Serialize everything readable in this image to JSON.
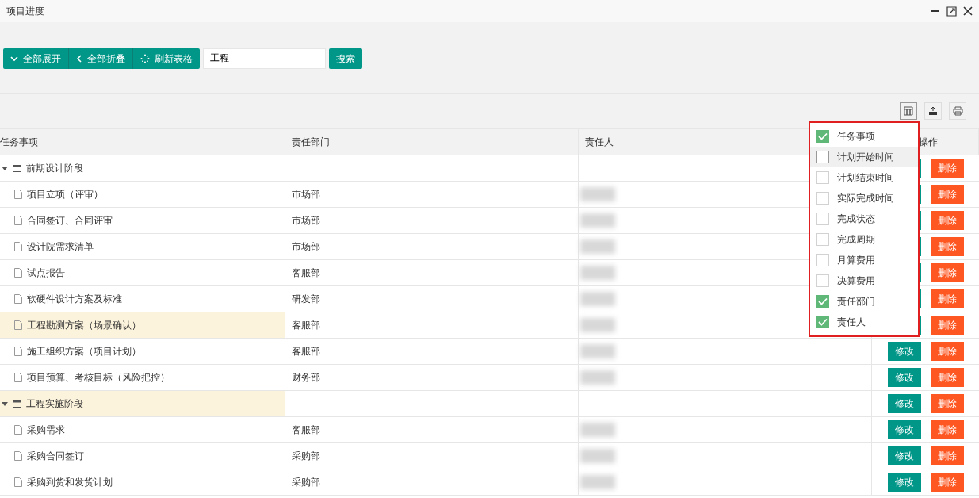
{
  "window": {
    "title": "项目进度"
  },
  "toolbar": {
    "buttons": [
      {
        "kind": "expand",
        "label": "全部展开"
      },
      {
        "kind": "collapse",
        "label": "全部折叠"
      },
      {
        "kind": "refresh",
        "label": "刷新表格"
      }
    ],
    "search": {
      "value": "工程"
    },
    "search_button": "搜索"
  },
  "table": {
    "columns": [
      "任务事项",
      "责任部门",
      "责任人",
      "操作"
    ],
    "rows": [
      {
        "kind": "group",
        "task": "前期设计阶段",
        "expanded": true,
        "highlighted": false,
        "actions": [
          "删除"
        ]
      },
      {
        "kind": "item",
        "task": "项目立项（评审）",
        "dept": "市场部",
        "highlighted": false,
        "actions": [
          "删除"
        ]
      },
      {
        "kind": "item",
        "task": "合同签订、合同评审",
        "dept": "市场部",
        "highlighted": false,
        "actions": [
          "删除"
        ]
      },
      {
        "kind": "item",
        "task": "设计院需求清单",
        "dept": "市场部",
        "highlighted": false,
        "actions": [
          "删除"
        ]
      },
      {
        "kind": "item",
        "task": "试点报告",
        "dept": "客服部",
        "highlighted": false,
        "actions": [
          "删除"
        ]
      },
      {
        "kind": "item",
        "task": "软硬件设计方案及标准",
        "dept": "研发部",
        "highlighted": false,
        "actions": [
          "删除"
        ]
      },
      {
        "kind": "item",
        "task": "工程勘测方案（场景确认）",
        "dept": "客服部",
        "highlighted": true,
        "actions": [
          "删除"
        ]
      },
      {
        "kind": "item",
        "task": "施工组织方案（项目计划）",
        "dept": "客服部",
        "highlighted": false,
        "actions": [
          "修改",
          "删除"
        ]
      },
      {
        "kind": "item",
        "task": "项目预算、考核目标（风险把控）",
        "dept": "财务部",
        "highlighted": false,
        "actions": [
          "修改",
          "删除"
        ]
      },
      {
        "kind": "group",
        "task": "工程实施阶段",
        "expanded": true,
        "highlighted": true,
        "actions": [
          "修改",
          "删除"
        ]
      },
      {
        "kind": "item",
        "task": "采购需求",
        "dept": "客服部",
        "highlighted": false,
        "actions": [
          "修改",
          "删除"
        ]
      },
      {
        "kind": "item",
        "task": "采购合同签订",
        "dept": "采购部",
        "highlighted": false,
        "actions": [
          "修改",
          "删除"
        ]
      },
      {
        "kind": "item",
        "task": "采购到货和发货计划",
        "dept": "采购部",
        "highlighted": false,
        "actions": [
          "修改",
          "删除"
        ]
      }
    ]
  },
  "column_menu": {
    "items": [
      {
        "label": "任务事项",
        "checked": true,
        "hovered": false
      },
      {
        "label": "计划开始时间",
        "checked": false,
        "hovered": true
      },
      {
        "label": "计划结束时间",
        "checked": false,
        "hovered": false
      },
      {
        "label": "实际完成时间",
        "checked": false,
        "hovered": false
      },
      {
        "label": "完成状态",
        "checked": false,
        "hovered": false
      },
      {
        "label": "完成周期",
        "checked": false,
        "hovered": false
      },
      {
        "label": "月算费用",
        "checked": false,
        "hovered": false
      },
      {
        "label": "决算费用",
        "checked": false,
        "hovered": false
      },
      {
        "label": "责任部门",
        "checked": true,
        "hovered": false
      },
      {
        "label": "责任人",
        "checked": true,
        "hovered": false
      }
    ]
  }
}
